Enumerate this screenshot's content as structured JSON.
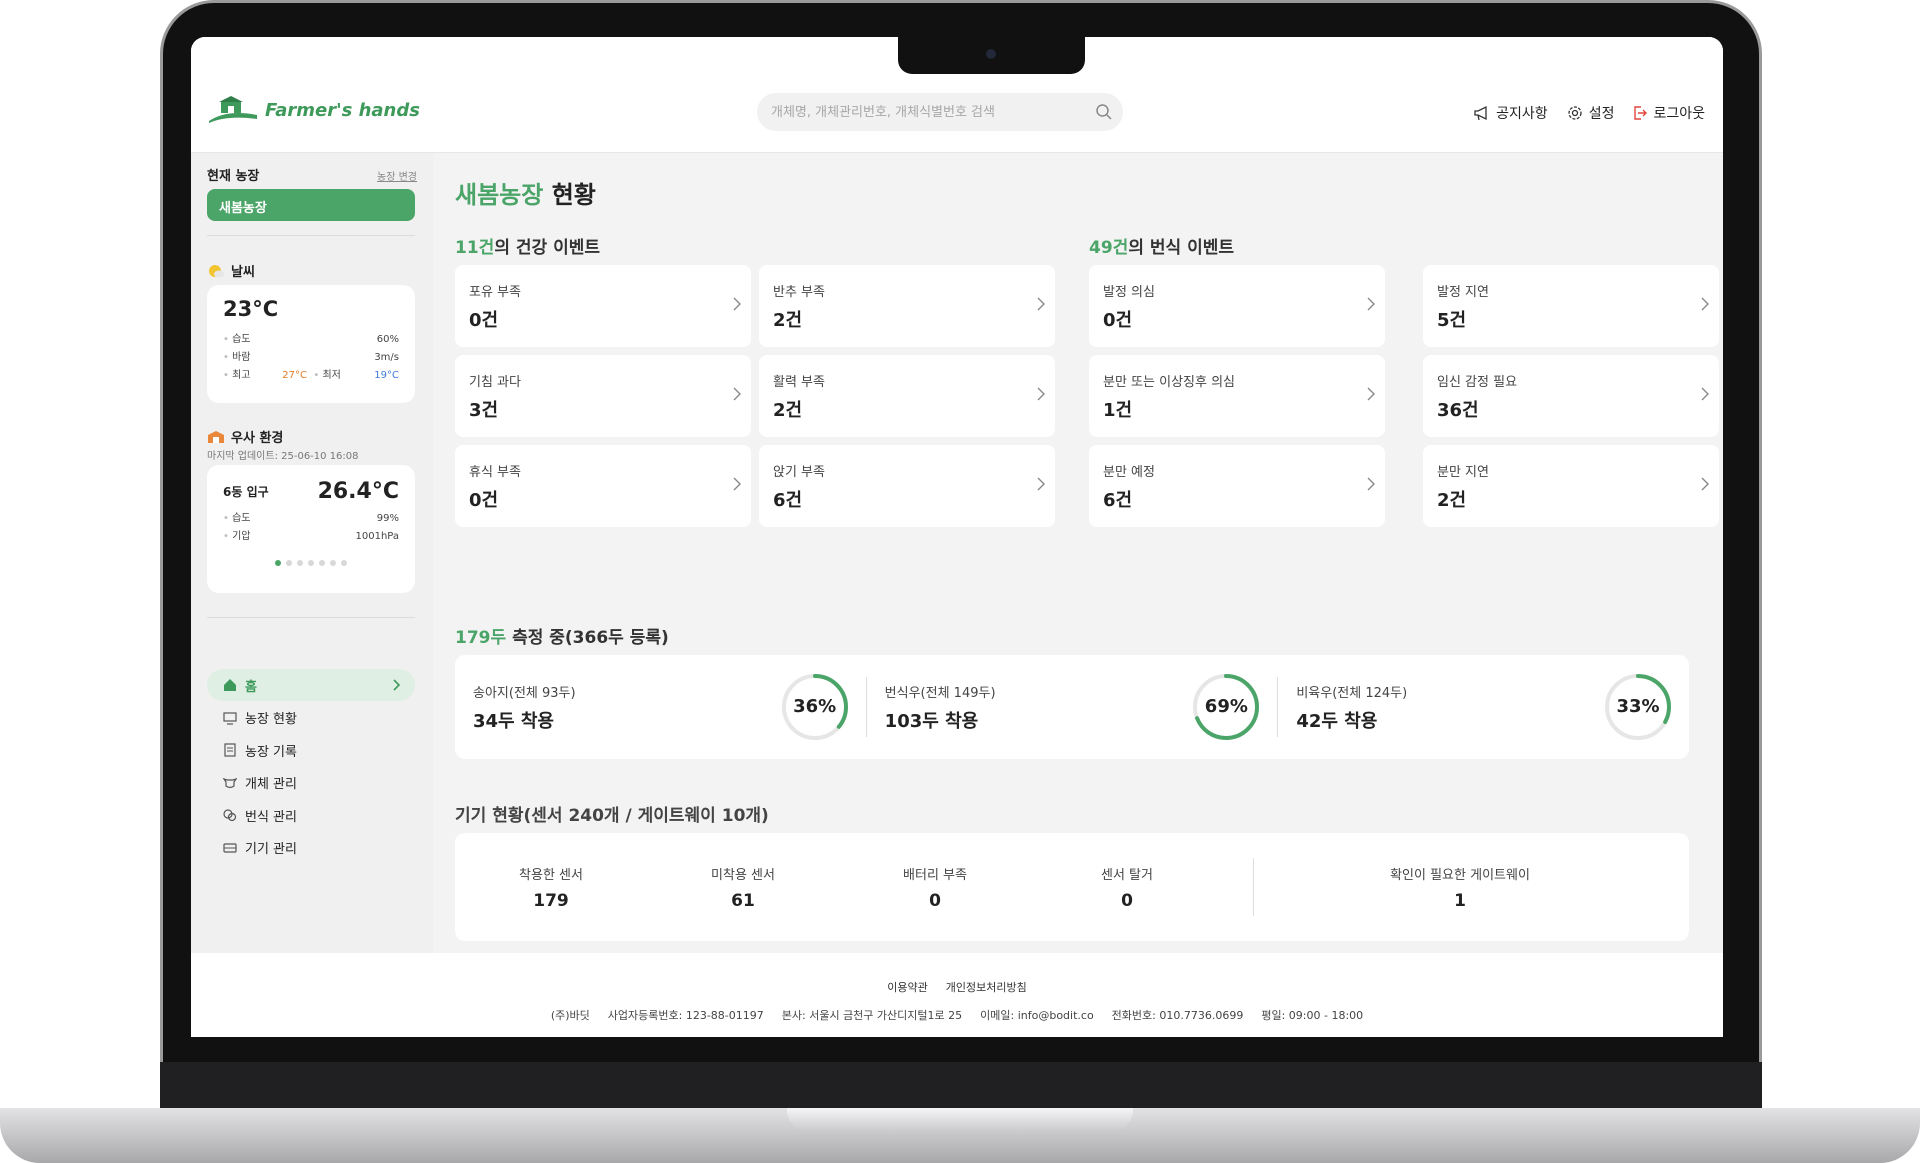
{
  "header": {
    "logo_text": "Farmer's hands",
    "search_placeholder": "개체명, 개체관리번호, 개체식별번호 검색",
    "nav": {
      "notice": "공지사항",
      "settings": "설정",
      "logout": "로그아웃"
    }
  },
  "sidebar": {
    "current_farm_label": "현재 농장",
    "farm_change": "농장 변경",
    "farm_name": "새봄농장",
    "weather": {
      "title": "날씨",
      "temp": "23°C",
      "humidity_label": "습도",
      "humidity": "60%",
      "wind_label": "바람",
      "wind": "3m/s",
      "high_label": "최고",
      "high": "27°C",
      "low_label": "최저",
      "low": "19°C"
    },
    "barn": {
      "title": "우사 환경",
      "updated": "마지막 업데이트: 25-06-10 16:08",
      "name": "6동 입구",
      "temp": "26.4°C",
      "humidity_label": "습도",
      "humidity": "99%",
      "pressure_label": "기압",
      "pressure": "1001hPa"
    },
    "menu": [
      "홈",
      "농장 현황",
      "농장 기록",
      "개체 관리",
      "번식 관리",
      "기기 관리"
    ]
  },
  "main": {
    "title_farm": "새봄농장",
    "title_rest": "현황",
    "health": {
      "count": "11건",
      "title_rest": "의 건강 이벤트",
      "items": [
        {
          "label": "포유 부족",
          "value": "0건"
        },
        {
          "label": "반추 부족",
          "value": "2건"
        },
        {
          "label": "기침 과다",
          "value": "3건"
        },
        {
          "label": "활력 부족",
          "value": "2건"
        },
        {
          "label": "휴식 부족",
          "value": "0건"
        },
        {
          "label": "앉기 부족",
          "value": "6건"
        }
      ]
    },
    "breeding": {
      "count": "49건",
      "title_rest": "의 번식 이벤트",
      "items": [
        {
          "label": "발정 의심",
          "value": "0건"
        },
        {
          "label": "발정 지연",
          "value": "5건"
        },
        {
          "label": "분만 또는 이상징후 의심",
          "value": "1건"
        },
        {
          "label": "임신 감정 필요",
          "value": "36건"
        },
        {
          "label": "분만 예정",
          "value": "6건"
        },
        {
          "label": "분만 지연",
          "value": "2건"
        }
      ]
    },
    "measuring": {
      "count": "179두",
      "title_rest": "측정 중(366두 등록)",
      "items": [
        {
          "sub": "송아지(전체 93두)",
          "main": "34두 착용",
          "pct": "36%",
          "ratio": 0.36
        },
        {
          "sub": "번식우(전체 149두)",
          "main": "103두 착용",
          "pct": "69%",
          "ratio": 0.69
        },
        {
          "sub": "비육우(전체 124두)",
          "main": "42두 착용",
          "pct": "33%",
          "ratio": 0.33
        }
      ]
    },
    "devices": {
      "title": "기기 현황(센서 240개 / 게이트웨이 10개)",
      "items": [
        {
          "label": "착용한 센서",
          "value": "179"
        },
        {
          "label": "미착용 센서",
          "value": "61"
        },
        {
          "label": "배터리 부족",
          "value": "0"
        },
        {
          "label": "센서 탈거",
          "value": "0"
        }
      ],
      "gateway": {
        "label": "확인이 필요한 게이트웨이",
        "value": "1"
      }
    }
  },
  "footer": {
    "links": [
      "이용약관",
      "개인정보처리방침"
    ],
    "info": [
      "(주)바딧",
      "사업자등록번호: 123-88-01197",
      "본사: 서울시 금천구 가산디지털1로 25",
      "이메일: info@bodit.co",
      "전화번호: 010.7736.0699",
      "평일: 09:00 - 18:00"
    ]
  },
  "colors": {
    "accent": "#4ba568",
    "high": "#e67b22",
    "low": "#3f7ad9"
  }
}
